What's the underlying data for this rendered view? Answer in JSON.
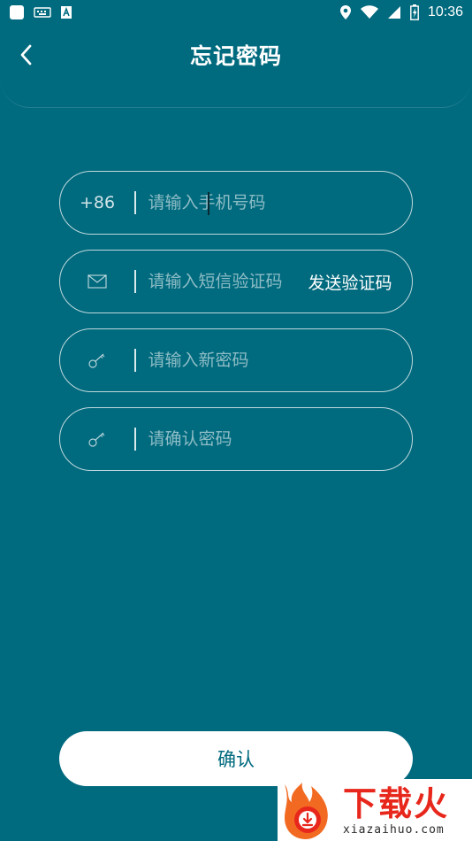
{
  "status_bar": {
    "time": "10:36"
  },
  "header": {
    "title": "忘记密码"
  },
  "form": {
    "phone": {
      "prefix": "+86",
      "placeholder": "请输入手机号码",
      "value": ""
    },
    "sms_code": {
      "placeholder": "请输入短信验证码",
      "value": "",
      "send_label": "发送验证码"
    },
    "new_password": {
      "placeholder": "请输入新密码",
      "value": ""
    },
    "confirm_password": {
      "placeholder": "请确认密码",
      "value": ""
    }
  },
  "confirm_button": {
    "label": "确认"
  },
  "watermark": {
    "title": "下载火",
    "subtitle": "xiazaihuo.com"
  },
  "colors": {
    "background": "#006A7E",
    "brand_red": "#E8271C",
    "white": "#FFFFFF"
  },
  "icons": {
    "phone_prefix": "text",
    "sms": "envelope-icon",
    "password": "key-icon",
    "back": "chevron-left-icon"
  }
}
